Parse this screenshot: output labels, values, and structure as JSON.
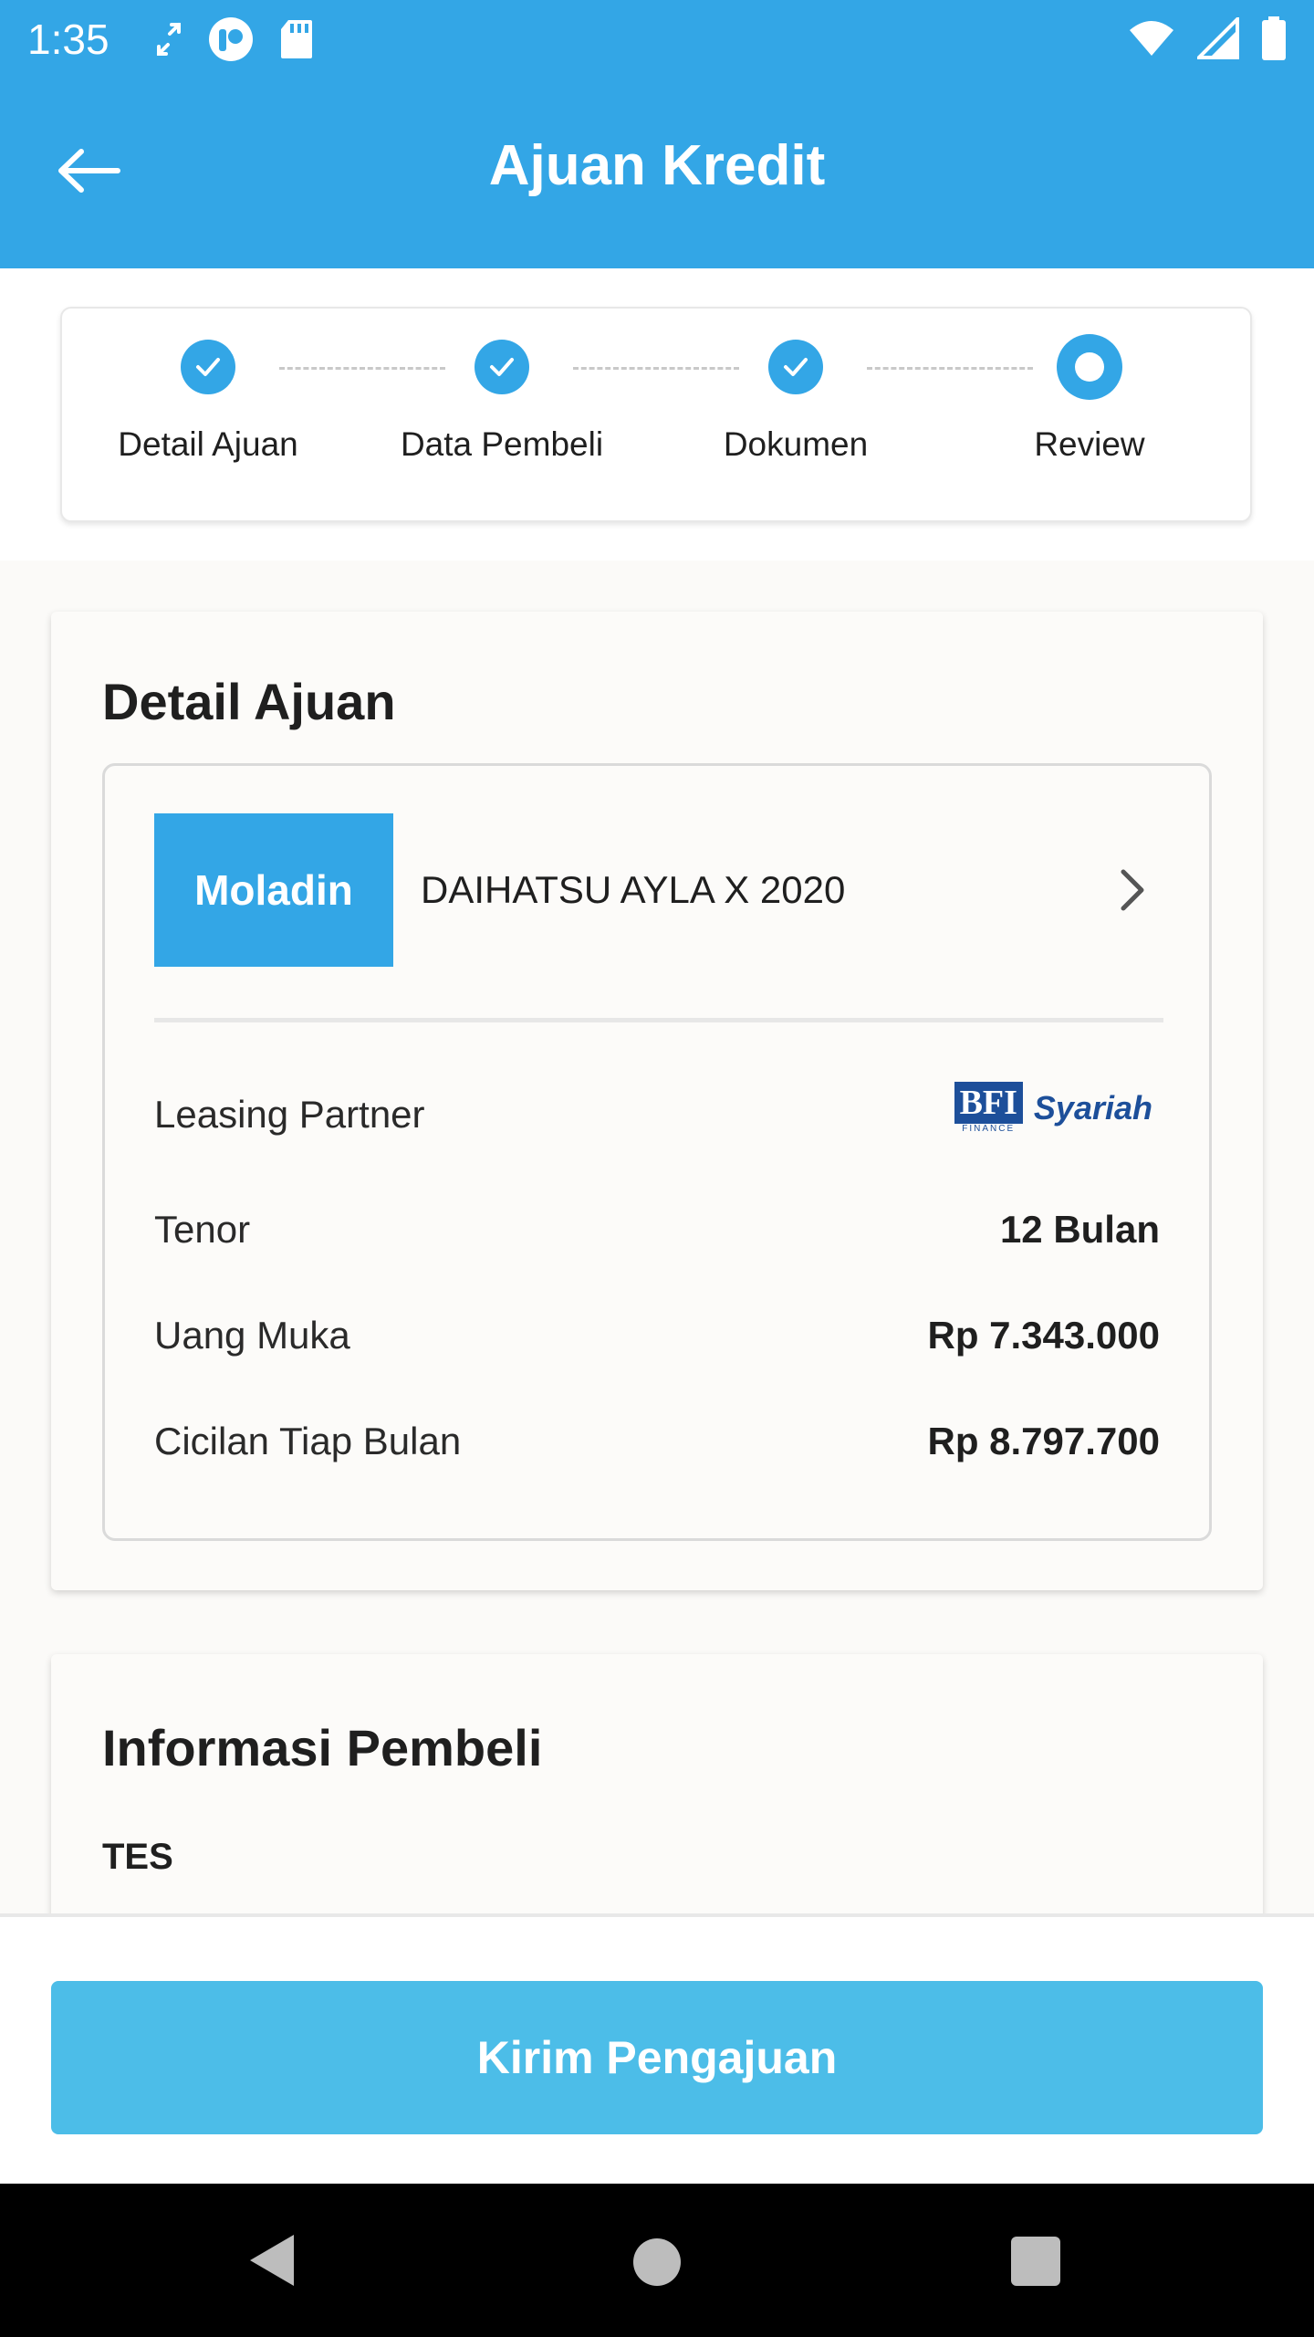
{
  "status_bar": {
    "time": "1:35",
    "icons_left": [
      "sync-icon",
      "app-notification-icon",
      "sd-card-icon"
    ],
    "icons_right": [
      "wifi-icon",
      "signal-icon",
      "battery-icon"
    ]
  },
  "app_bar": {
    "title": "Ajuan Kredit",
    "back_icon": "arrow-left-icon"
  },
  "stepper": {
    "steps": [
      {
        "label": "Detail Ajuan",
        "state": "done"
      },
      {
        "label": "Data Pembeli",
        "state": "done"
      },
      {
        "label": "Dokumen",
        "state": "done"
      },
      {
        "label": "Review",
        "state": "current"
      }
    ]
  },
  "detail_ajuan": {
    "title": "Detail Ajuan",
    "logo_text": "Moladin",
    "car_name": "DAIHATSU AYLA X 2020",
    "rows": [
      {
        "label": "Leasing Partner",
        "value": ""
      },
      {
        "label": "Tenor",
        "value": "12 Bulan"
      },
      {
        "label": "Uang Muka",
        "value": "Rp 7.343.000"
      },
      {
        "label": "Cicilan Tiap Bulan",
        "value": "Rp 8.797.700"
      }
    ],
    "leasing_logo": {
      "text_main": "BFI",
      "text_sub": "FINANCE",
      "text_right": "Syariah"
    }
  },
  "informasi_pembeli": {
    "title": "Informasi Pembeli",
    "name": "TES"
  },
  "submit": {
    "label": "Kirim Pengajuan"
  },
  "colors": {
    "primary": "#33a6e6",
    "button": "#4cbde8",
    "bfi_blue": "#1d4f9a"
  }
}
